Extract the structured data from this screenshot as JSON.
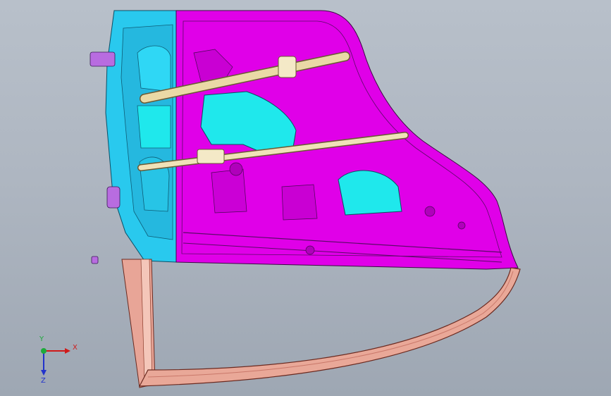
{
  "triad": {
    "x_label": "X",
    "y_label": "Y",
    "z_label": "Z"
  },
  "colors": {
    "background_top": "#b8c0ca",
    "background_bottom": "#9ea7b3",
    "inner_panel": "#e000e8",
    "outer_panel": "#29c9ee",
    "glass_cutout": "#1fe8ec",
    "rail": "#ead9a6",
    "frame": "#e8a597"
  },
  "icons": [
    "coordinate-triad-icon"
  ]
}
